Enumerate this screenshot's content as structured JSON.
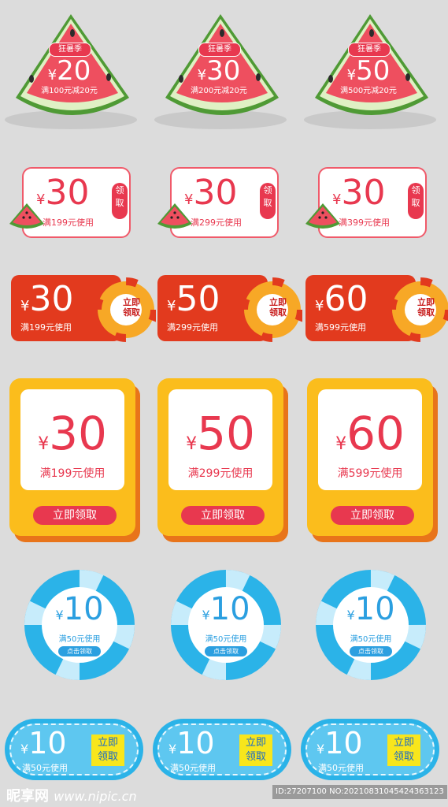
{
  "watermelon_coupons": [
    {
      "tag": "狂暑季",
      "currency": "¥",
      "amount": "20",
      "condition": "满100元减20元"
    },
    {
      "tag": "狂暑季",
      "currency": "¥",
      "amount": "30",
      "condition": "满200元减20元"
    },
    {
      "tag": "狂暑季",
      "currency": "¥",
      "amount": "50",
      "condition": "满500元减20元"
    }
  ],
  "white_coupons": [
    {
      "currency": "¥",
      "amount": "30",
      "condition": "满199元使用",
      "button": "领取"
    },
    {
      "currency": "¥",
      "amount": "30",
      "condition": "满299元使用",
      "button": "领取"
    },
    {
      "currency": "¥",
      "amount": "30",
      "condition": "满399元使用",
      "button": "领取"
    }
  ],
  "red_coupons": [
    {
      "currency": "¥",
      "amount": "30",
      "condition": "满199元使用",
      "button": "立即领取"
    },
    {
      "currency": "¥",
      "amount": "50",
      "condition": "满299元使用",
      "button": "立即领取"
    },
    {
      "currency": "¥",
      "amount": "60",
      "condition": "满599元使用",
      "button": "立即领取"
    }
  ],
  "yellow_coupons": [
    {
      "currency": "¥",
      "amount": "30",
      "condition": "满199元使用",
      "button": "立即领取"
    },
    {
      "currency": "¥",
      "amount": "50",
      "condition": "满299元使用",
      "button": "立即领取"
    },
    {
      "currency": "¥",
      "amount": "60",
      "condition": "满599元使用",
      "button": "立即领取"
    }
  ],
  "ring_coupons": [
    {
      "currency": "¥",
      "amount": "10",
      "condition": "满50元使用",
      "button": "点击领取"
    },
    {
      "currency": "¥",
      "amount": "10",
      "condition": "满50元使用",
      "button": "点击领取"
    },
    {
      "currency": "¥",
      "amount": "10",
      "condition": "满50元使用",
      "button": "点击领取"
    }
  ],
  "pill_coupons": [
    {
      "currency": "¥",
      "amount": "10",
      "condition": "满50元使用",
      "button": "立即领取"
    },
    {
      "currency": "¥",
      "amount": "10",
      "condition": "满50元使用",
      "button": "立即领取"
    },
    {
      "currency": "¥",
      "amount": "10",
      "condition": "满50元使用",
      "button": "立即领取"
    }
  ],
  "footer": {
    "logo": "昵享网",
    "site": "www.nipic.cn",
    "id_text": "ID:27207100 NO:20210831045424363123"
  },
  "colors": {
    "background": "#dcdcdc",
    "watermelon_red": "#e8384f",
    "coupon_red": "#e23a1e",
    "coupon_yellow": "#fbbd1c",
    "coupon_blue": "#2bb3e8",
    "button_yellow": "#f8e61c"
  }
}
